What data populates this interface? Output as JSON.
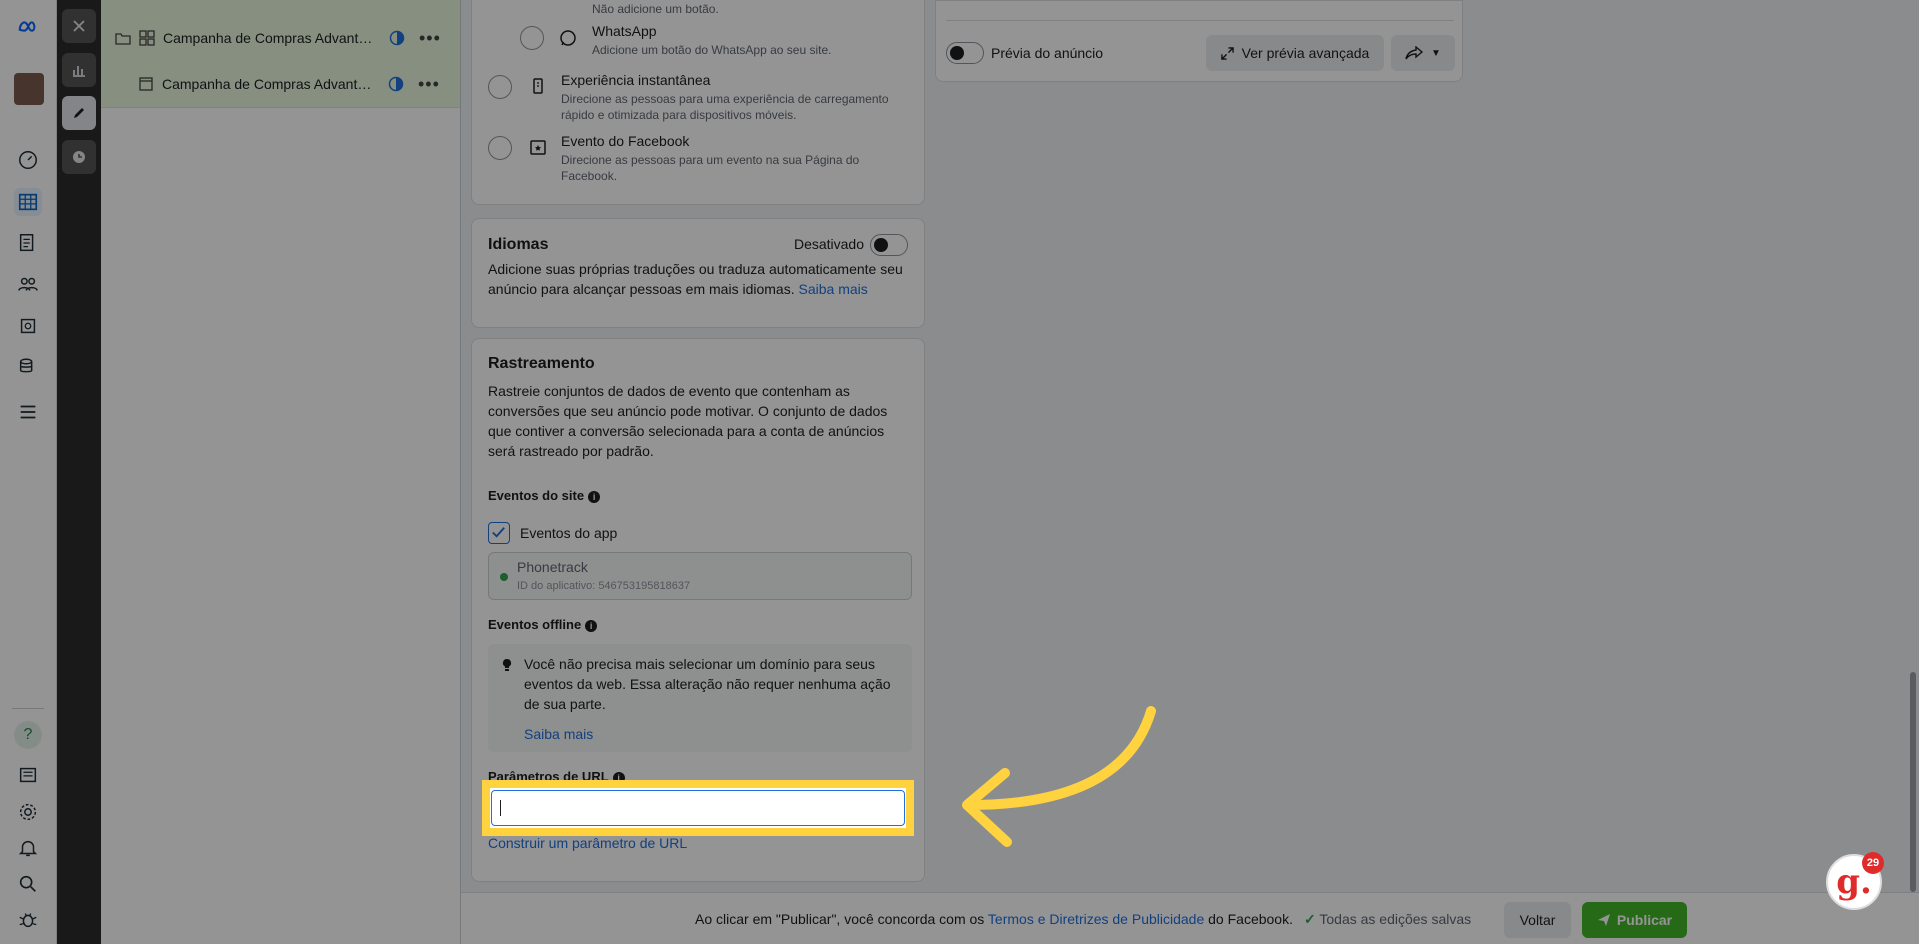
{
  "tree": {
    "campaign_label": "Campanha de Compras Advanta...",
    "ad_label": "Campanha de Compras Advanta..."
  },
  "options": {
    "none_desc": "Não adicione um botão.",
    "whatsapp_title": "WhatsApp",
    "whatsapp_desc": "Adicione um botão do WhatsApp ao seu site.",
    "instant_title": "Experiência instantânea",
    "instant_desc": "Direcione as pessoas para uma experiência de carregamento rápido e otimizada para dispositivos móveis.",
    "event_title": "Evento do Facebook",
    "event_desc": "Direcione as pessoas para um evento na sua Página do Facebook."
  },
  "languages": {
    "title": "Idiomas",
    "toggle_label": "Desativado",
    "desc": "Adicione suas próprias traduções ou traduza automaticamente seu anúncio para alcançar pessoas em mais idiomas.",
    "link": "Saiba mais"
  },
  "tracking": {
    "title": "Rastreamento",
    "desc": "Rastreie conjuntos de dados de evento que contenham as conversões que seu anúncio pode motivar. O conjunto de dados que contiver a conversão selecionada para a conta de anúncios será rastreado por padrão.",
    "site_events": "Eventos do site",
    "app_events": "Eventos do app",
    "app_name": "Phonetrack",
    "app_id": "ID do aplicativo: 546753195818637",
    "offline_events": "Eventos offline",
    "tip": "Você não precisa mais selecionar um domínio para seus eventos da web. Essa alteração não requer nenhuma ação de sua parte.",
    "tip_link": "Saiba mais",
    "url_params": "Parâmetros de URL",
    "url_input_value": "",
    "build_link": "Construir um parâmetro de URL"
  },
  "preview": {
    "toggle_label": "Prévia do anúncio",
    "advanced_button": "Ver prévia avançada"
  },
  "bottom": {
    "agree_prefix": "Ao clicar em \"Publicar\", você concorda com os",
    "terms_link": "Termos e Diretrizes de Publicidade",
    "agree_suffix": "do Facebook.",
    "saved": "Todas as edições salvas",
    "back": "Voltar",
    "publish": "Publicar"
  },
  "help_badge": {
    "count": "29"
  },
  "colors": {
    "accent": "#216fdb",
    "publish": "#42b72a",
    "highlight": "#ffd23f"
  }
}
